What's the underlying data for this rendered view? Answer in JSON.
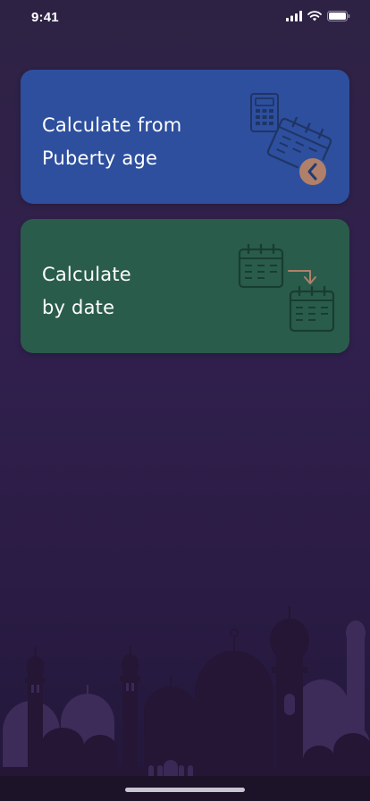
{
  "status_bar": {
    "time": "9:41",
    "icons": [
      "signal-icon",
      "wifi-icon",
      "battery-icon"
    ]
  },
  "cards": [
    {
      "id": "puberty",
      "title_line1": "Calculate from",
      "title_line2": "Puberty age",
      "color": "#2e4f9e",
      "icons": [
        "calculator-icon",
        "calendar-icon",
        "back-arrow-badge-icon"
      ]
    },
    {
      "id": "date",
      "title_line1": "Calculate",
      "title_line2": "by date",
      "color": "#2a5c4c",
      "icons": [
        "calendar-icon",
        "arrow-down-right-icon",
        "calendar-icon"
      ]
    }
  ],
  "background": {
    "colors": [
      "#2e2244",
      "#22173a"
    ],
    "decor": "mosque-skyline-silhouette"
  }
}
